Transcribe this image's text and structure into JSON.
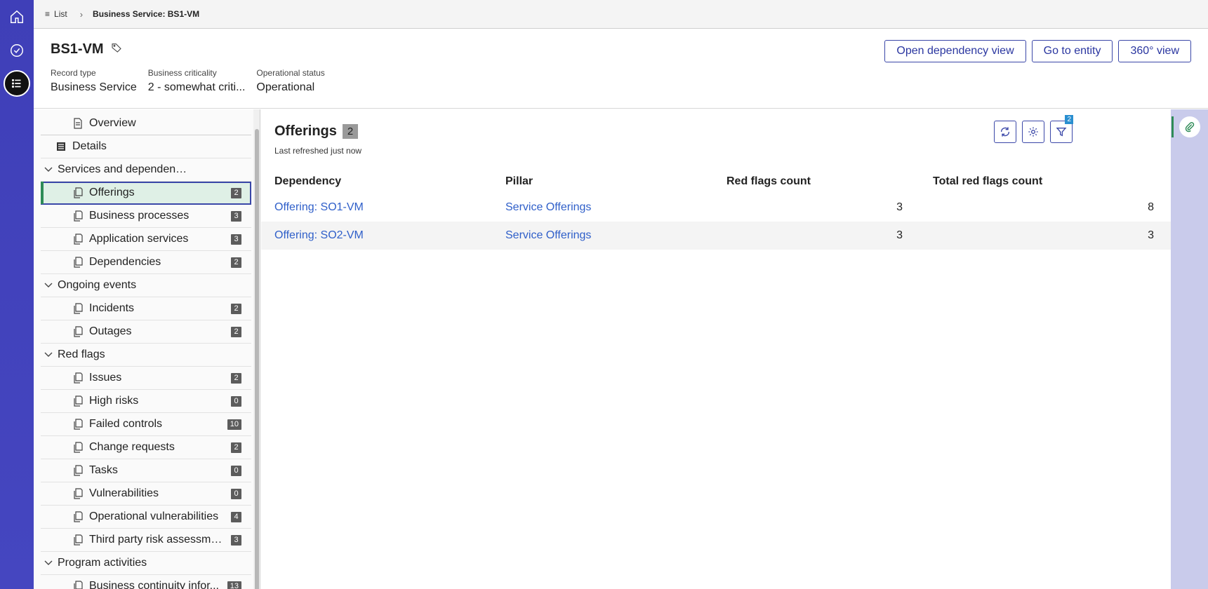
{
  "rail": {
    "items": [
      {
        "icon": "home-icon"
      },
      {
        "icon": "check-circle-icon"
      },
      {
        "icon": "list-icon",
        "active": true
      }
    ]
  },
  "breadcrumb": {
    "list_label": "List",
    "current": "Business Service: BS1-VM"
  },
  "record": {
    "title": "BS1-VM",
    "fields": [
      {
        "label": "Record type",
        "value": "Business Service"
      },
      {
        "label": "Business criticality",
        "value": "2 - somewhat criti..."
      },
      {
        "label": "Operational status",
        "value": "Operational"
      }
    ],
    "actions": {
      "dependency_view": "Open dependency view",
      "go_to_entity": "Go to entity",
      "view_360": "360° view"
    }
  },
  "sidebar": {
    "overview": "Overview",
    "details": "Details",
    "groups": [
      {
        "label": "Services and dependencies",
        "items": [
          {
            "label": "Offerings",
            "count": "2",
            "selected": true
          },
          {
            "label": "Business processes",
            "count": "3"
          },
          {
            "label": "Application services",
            "count": "3"
          },
          {
            "label": "Dependencies",
            "count": "2"
          }
        ]
      },
      {
        "label": "Ongoing events",
        "items": [
          {
            "label": "Incidents",
            "count": "2"
          },
          {
            "label": "Outages",
            "count": "2"
          }
        ]
      },
      {
        "label": "Red flags",
        "items": [
          {
            "label": "Issues",
            "count": "2"
          },
          {
            "label": "High risks",
            "count": "0"
          },
          {
            "label": "Failed controls",
            "count": "10"
          },
          {
            "label": "Change requests",
            "count": "2"
          },
          {
            "label": "Tasks",
            "count": "0"
          },
          {
            "label": "Vulnerabilities",
            "count": "0"
          },
          {
            "label": "Operational vulnerabilities",
            "count": "4"
          },
          {
            "label": "Third party risk assessments",
            "count": "3"
          }
        ]
      },
      {
        "label": "Program activities",
        "items": [
          {
            "label": "Business continuity infor...",
            "count": "13"
          }
        ]
      }
    ]
  },
  "panel": {
    "title": "Offerings",
    "count": "2",
    "refreshed": "Last refreshed just now",
    "filter_badge": "2",
    "columns": [
      "Dependency",
      "Pillar",
      "Red flags count",
      "Total red flags count"
    ],
    "rows": [
      {
        "dependency": "Offering: SO1-VM",
        "pillar": "Service Offerings",
        "red_flags": "3",
        "total_red_flags": "8"
      },
      {
        "dependency": "Offering: SO2-VM",
        "pillar": "Service Offerings",
        "red_flags": "3",
        "total_red_flags": "3"
      }
    ]
  },
  "colors": {
    "rail": "#4546c0",
    "accent": "#3a47a8",
    "link": "#2f5fc9",
    "selected_bg": "#dff0e6",
    "selected_marker": "#2e8b57"
  }
}
